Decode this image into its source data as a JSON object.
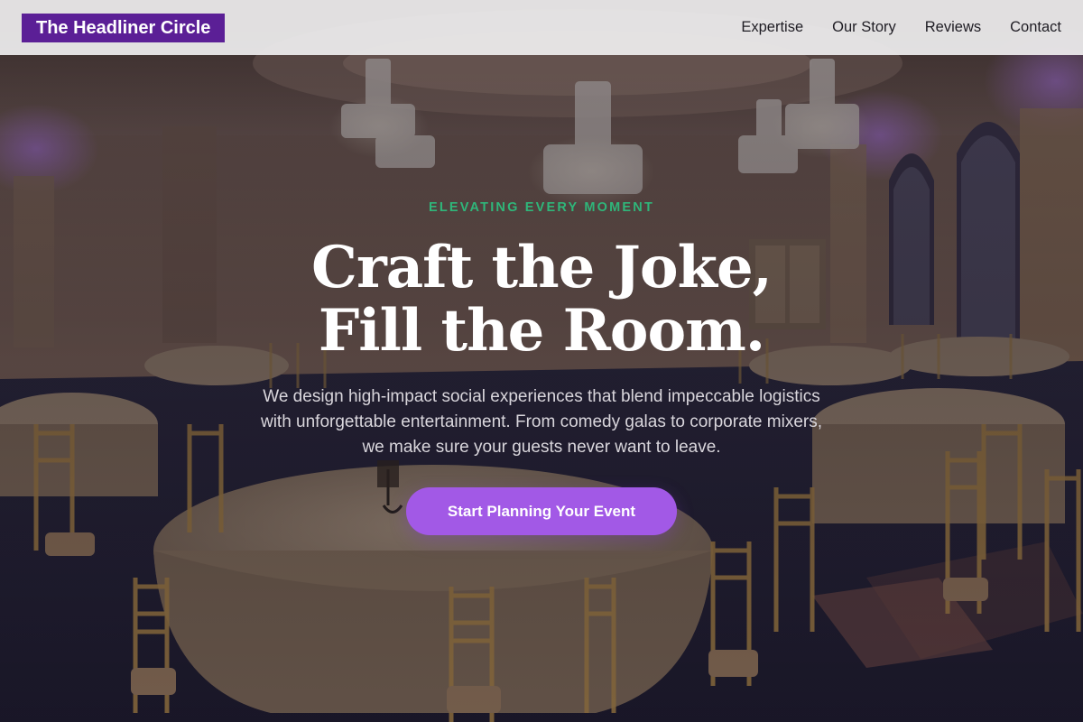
{
  "nav": {
    "brand": "The Headliner Circle",
    "links": [
      "Expertise",
      "Our Story",
      "Reviews",
      "Contact"
    ]
  },
  "hero": {
    "eyebrow": "ELEVATING EVERY MOMENT",
    "headline_line1": "Craft the Joke,",
    "headline_line2": "Fill the Room.",
    "subtext": "We design high-impact social experiences that blend impeccable logistics with unforgettable entertainment. From comedy galas to corporate mixers, we make sure your guests never want to leave.",
    "cta_label": "Start Planning Your Event",
    "background_image": "banquet-hall-with-chandeliers"
  },
  "colors": {
    "brand_bg": "#5b1f96",
    "eyebrow": "#2fb67a",
    "cta_bg": "#a259e6",
    "nav_bg": "#ecebec"
  }
}
